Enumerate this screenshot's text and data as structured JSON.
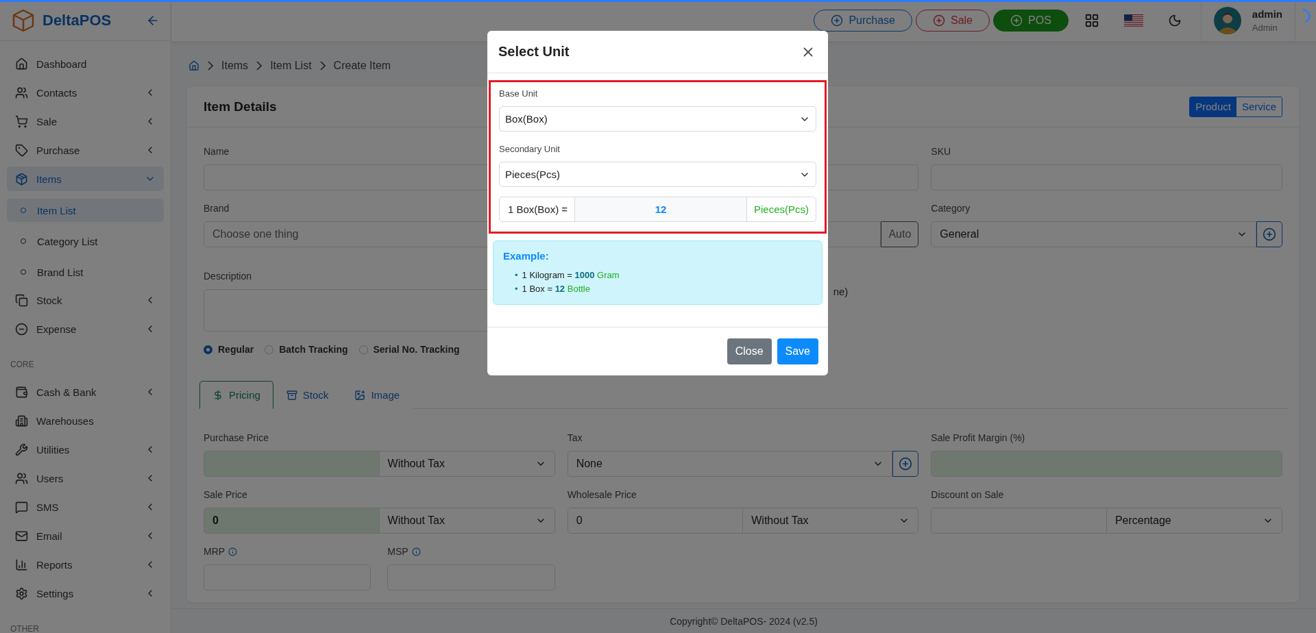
{
  "sidebar": {
    "brand": "DeltaPOS",
    "sections": [
      {
        "items": [
          {
            "label": "Dashboard",
            "kind": "link",
            "selected": false
          },
          {
            "label": "Contacts",
            "kind": "group",
            "expanded": false,
            "selected": false
          },
          {
            "label": "Sale",
            "kind": "group",
            "expanded": false,
            "selected": false
          },
          {
            "label": "Purchase",
            "kind": "group",
            "expanded": false,
            "selected": false
          },
          {
            "label": "Items",
            "kind": "group",
            "expanded": true,
            "selected": true,
            "children": [
              {
                "label": "Item List",
                "selected": true
              },
              {
                "label": "Category List",
                "selected": false
              },
              {
                "label": "Brand List",
                "selected": false
              }
            ]
          },
          {
            "label": "Stock",
            "kind": "group",
            "expanded": false,
            "selected": false
          },
          {
            "label": "Expense",
            "kind": "group",
            "expanded": false,
            "selected": false
          }
        ]
      },
      {
        "title": "CORE",
        "items": [
          {
            "label": "Cash & Bank",
            "kind": "group",
            "expanded": false,
            "selected": false
          },
          {
            "label": "Warehouses",
            "kind": "link",
            "selected": false
          },
          {
            "label": "Utilities",
            "kind": "group",
            "expanded": false,
            "selected": false
          },
          {
            "label": "Users",
            "kind": "group",
            "expanded": false,
            "selected": false
          },
          {
            "label": "SMS",
            "kind": "group",
            "expanded": false,
            "selected": false
          },
          {
            "label": "Email",
            "kind": "group",
            "expanded": false,
            "selected": false
          },
          {
            "label": "Reports",
            "kind": "group",
            "expanded": false,
            "selected": false
          },
          {
            "label": "Settings",
            "kind": "group",
            "expanded": false,
            "selected": false
          }
        ]
      },
      {
        "title": "OTHER"
      }
    ]
  },
  "header": {
    "actions": [
      {
        "label": "Purchase",
        "kind": "primary"
      },
      {
        "label": "Sale",
        "kind": "danger"
      },
      {
        "label": "POS",
        "kind": "success"
      }
    ],
    "user": {
      "name": "admin",
      "role": "Admin"
    }
  },
  "breadcrumb": [
    "Items",
    "Item List",
    "Create Item"
  ],
  "card": {
    "title": "Item Details",
    "type_toggle": [
      {
        "label": "Product",
        "selected": true
      },
      {
        "label": "Service",
        "selected": false
      }
    ],
    "name_field": {
      "label": "Name"
    },
    "sku_field": {
      "label": "SKU"
    },
    "brand_field": {
      "label": "Brand",
      "placeholder": "Choose one thing"
    },
    "code_field": {
      "button": "Auto"
    },
    "category_field": {
      "label": "Category",
      "value": "General"
    },
    "description_field": {
      "label": "Description"
    },
    "partial_text": "ne)",
    "tracking": [
      {
        "label": "Regular",
        "selected": true
      },
      {
        "label": "Batch Tracking",
        "selected": false
      },
      {
        "label": "Serial No. Tracking",
        "selected": false
      }
    ],
    "tabs": [
      {
        "label": "Pricing",
        "selected": true
      },
      {
        "label": "Stock",
        "selected": false
      },
      {
        "label": "Image",
        "selected": false
      }
    ],
    "pricing": {
      "purchase_price": {
        "label": "Purchase Price",
        "tax_mode": "Without Tax"
      },
      "tax": {
        "label": "Tax",
        "value": "None"
      },
      "profit_margin": {
        "label": "Sale Profit Margin (%)"
      },
      "sale_price": {
        "label": "Sale Price",
        "value": "0",
        "tax_mode": "Without Tax"
      },
      "wholesale_price": {
        "label": "Wholesale Price",
        "value": "0",
        "tax_mode": "Without Tax"
      },
      "discount": {
        "label": "Discount on Sale",
        "type": "Percentage"
      },
      "mrp": {
        "label": "MRP"
      },
      "msp": {
        "label": "MSP"
      }
    }
  },
  "footer": "Copyright© DeltaPOS- 2024 (v2.5)",
  "modal": {
    "title": "Select Unit",
    "highlighted": true,
    "base_unit": {
      "label": "Base Unit",
      "value": "Box(Box)"
    },
    "secondary_unit": {
      "label": "Secondary Unit",
      "value": "Pieces(Pcs)"
    },
    "conversion": {
      "prefix": "1 Box(Box) =",
      "value": "12",
      "suffix": "Pieces(Pcs)"
    },
    "example": {
      "title": "Example:",
      "items": [
        {
          "marker": "•",
          "left": "1 Kilogram =",
          "value": "1000",
          "unit": "Gram"
        },
        {
          "marker": "•",
          "left": "1 Box =",
          "value": "12",
          "unit": "Bottle"
        }
      ]
    },
    "buttons": [
      {
        "label": "Close",
        "kind": "secondary"
      },
      {
        "label": "Save",
        "kind": "primary"
      }
    ]
  }
}
